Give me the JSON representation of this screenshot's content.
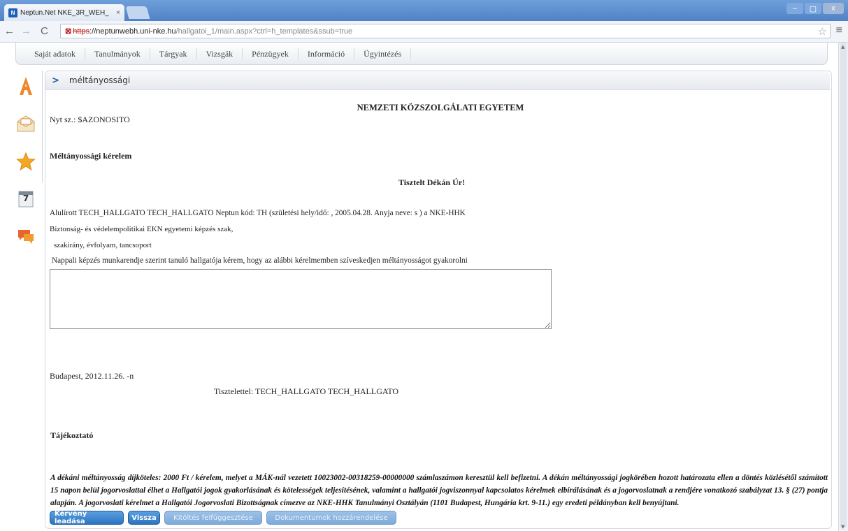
{
  "browser": {
    "tab_title": "Neptun.Net NKE_3R_WEH_",
    "tab_close": "×",
    "favicon_text": "N",
    "url_scheme": "https",
    "url_host": "://neptunwebh.uni-nke.hu",
    "url_path": "/hallgatoi_1/main.aspx?ctrl=h_templates&ssub=true",
    "win_minimize": "–",
    "win_maximize": "▢",
    "win_close": "x"
  },
  "main_menu": [
    "Saját adatok",
    "Tanulmányok",
    "Tárgyak",
    "Vizsgák",
    "Pénzügyek",
    "Információ",
    "Ügyintézés"
  ],
  "side_icons": [
    "a-letter-icon",
    "mail-icon",
    "star-icon",
    "calendar-icon",
    "chat-icon"
  ],
  "calendar_day": "7",
  "panel": {
    "title": "méltányossági"
  },
  "document": {
    "university": "NEMZETI KÖZSZOLGÁLATI EGYETEM",
    "registry": "Nyt sz.: $AZONOSITO",
    "heading": "Méltányossági kérelem",
    "salutation": "Tisztelt Dékán Úr!",
    "line1": "Alulírott TECH_HALLGATO TECH_HALLGATO Neptun kód: TH (születési hely/idő: , 2005.04.28.  Anyja neve: s ) a NKE-HHK",
    "line2": "Biztonság- és védelempolitikai EKN egyetemi képzés szak,",
    "line3": "szakirány,  évfolyam,  tancsoport",
    "line4": "Nappali képzés munkarendje szerint tanuló hallgatója kérem, hogy az alábbi kérelmemben szíveskedjen méltányosságot gyakorolni",
    "textarea_value": "",
    "place_date": "Budapest, 2012.11.26. -n",
    "closing": "Tisztelettel:  TECH_HALLGATO TECH_HALLGATO",
    "info_heading": "Tájékoztató",
    "info_text": "A dékáni méltányosság díjköteles: 2000 Ft / kérelem, melyet a MÁK-nál vezetett 10023002-00318259-00000000 számlaszámon keresztül kell befizetni. A dékán méltányossági jogkörében hozott határozata ellen a döntés közlésétől számított 15 napon belül jogorvoslattal élhet a Hallgatói jogok gyakorlásának és kötelességek teljesítésének, valamint a hallgatói jogviszonnyal kapcsolatos kérelmek elbírálásának és a jogorvoslatnak a rendjére vonatkozó szabályzat 13. § (27) pontja alapján. A jogorvoslati kérelmet a Hallgatói Jogorvoslati Bizottságnak címezve az NKE-HHK Tanulmányi Osztályán (1101 Budapest, Hungária krt. 9-11.) egy eredeti példányban kell benyújtani."
  },
  "buttons": {
    "submit": "Kérvény leadása",
    "back": "Vissza",
    "suspend": "Kitöltés felfüggesztése",
    "attach": "Dokumentumok hozzárendelése"
  },
  "colors": {
    "accent": "#2c74c0",
    "titlebar": "#5a8dcf"
  }
}
